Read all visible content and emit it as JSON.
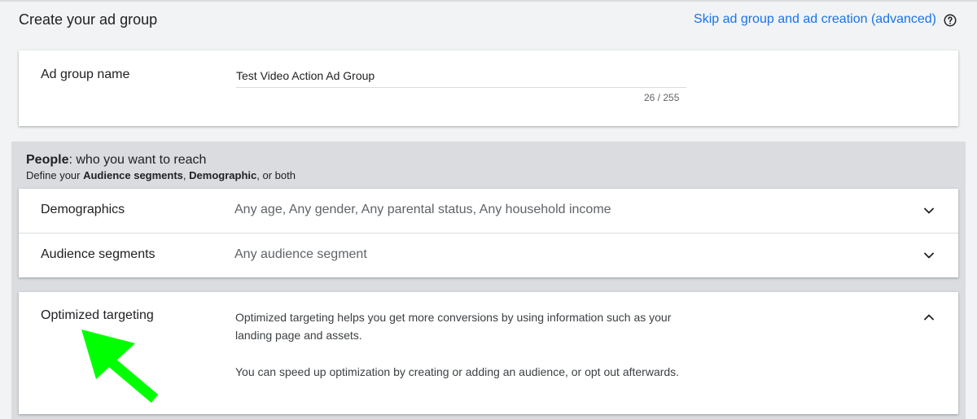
{
  "header": {
    "title": "Create your ad group",
    "skip_link": "Skip ad group and ad creation (advanced)",
    "help_icon": "help-circle-icon"
  },
  "ad_group": {
    "label": "Ad group name",
    "value": "Test Video Action Ad Group",
    "char_count": "26 / 255"
  },
  "people": {
    "title_bold": "People",
    "title_rest": ": who you want to reach",
    "sub_prefix": "Define your ",
    "sub_bold_1": "Audience segments",
    "sub_sep": ", ",
    "sub_bold_2": "Demographic",
    "sub_suffix": ", or both",
    "rows": [
      {
        "label": "Demographics",
        "value": "Any age, Any gender, Any parental status, Any household income",
        "icon": "chevron-down-icon"
      },
      {
        "label": "Audience segments",
        "value": "Any audience segment",
        "icon": "chevron-down-icon"
      }
    ]
  },
  "optimized": {
    "label": "Optimized targeting",
    "paragraph_1": "Optimized targeting helps you get more conversions by using information such as your landing page and assets.",
    "paragraph_2": "You can speed up optimization by creating or adding an audience, or opt out afterwards.",
    "icon": "chevron-up-icon"
  },
  "colors": {
    "link": "#1a73e8",
    "arrow": "#00ff00",
    "panel": "#dadce0"
  }
}
